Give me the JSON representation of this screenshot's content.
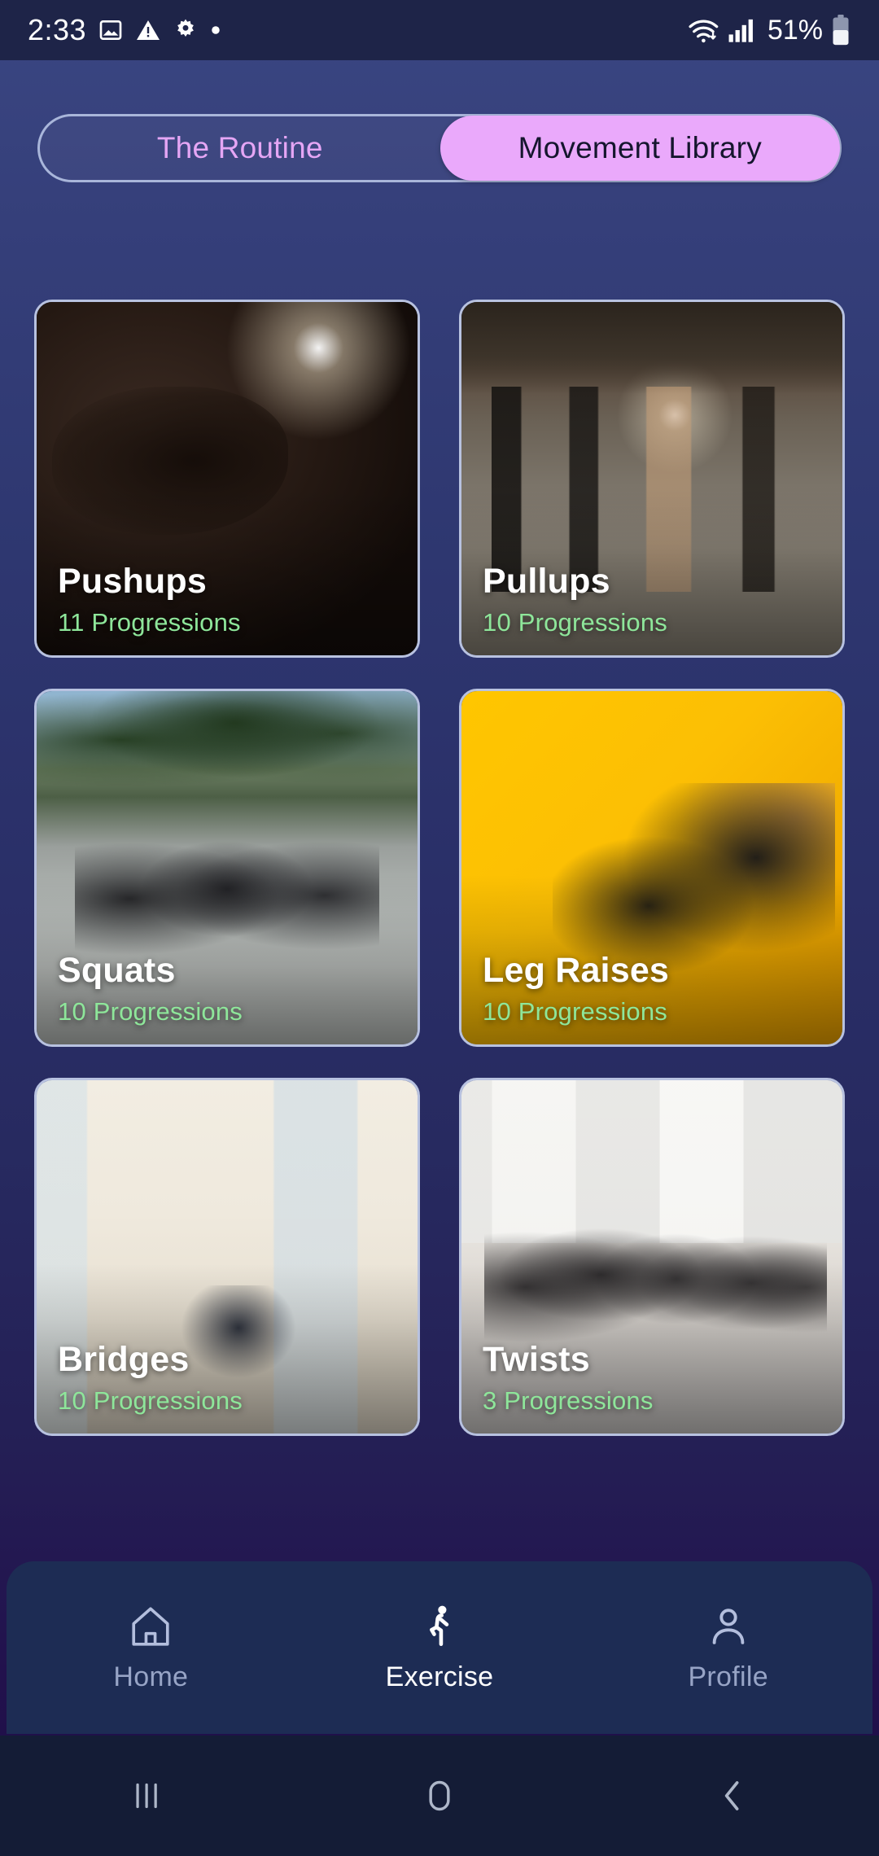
{
  "status_bar": {
    "time": "2:33",
    "battery_percent": "51%",
    "left_icons": [
      "image-icon",
      "warning-icon",
      "gear-icon",
      "dot-icon"
    ],
    "right_icons": [
      "wifi-icon",
      "cellular-signal-icon",
      "battery-icon"
    ]
  },
  "segmented_control": {
    "options": [
      {
        "label": "The Routine",
        "active": false
      },
      {
        "label": "Movement Library",
        "active": true
      }
    ],
    "active_bg": "#eaa9fb",
    "inactive_text": "#e5a6f5"
  },
  "library": {
    "progressions_color": "#8ee69a",
    "cards": [
      {
        "title": "Pushups",
        "subtitle": "11 Progressions"
      },
      {
        "title": "Pullups",
        "subtitle": "10 Progressions"
      },
      {
        "title": "Squats",
        "subtitle": "10 Progressions"
      },
      {
        "title": "Leg Raises",
        "subtitle": "10 Progressions"
      },
      {
        "title": "Bridges",
        "subtitle": "10 Progressions"
      },
      {
        "title": "Twists",
        "subtitle": "3 Progressions"
      }
    ]
  },
  "bottom_nav": {
    "items": [
      {
        "label": "Home",
        "icon": "home-icon",
        "active": false
      },
      {
        "label": "Exercise",
        "icon": "running-icon",
        "active": true
      },
      {
        "label": "Profile",
        "icon": "person-icon",
        "active": false
      }
    ]
  },
  "system_nav": {
    "buttons": [
      "recents-button",
      "home-button",
      "back-button"
    ]
  }
}
